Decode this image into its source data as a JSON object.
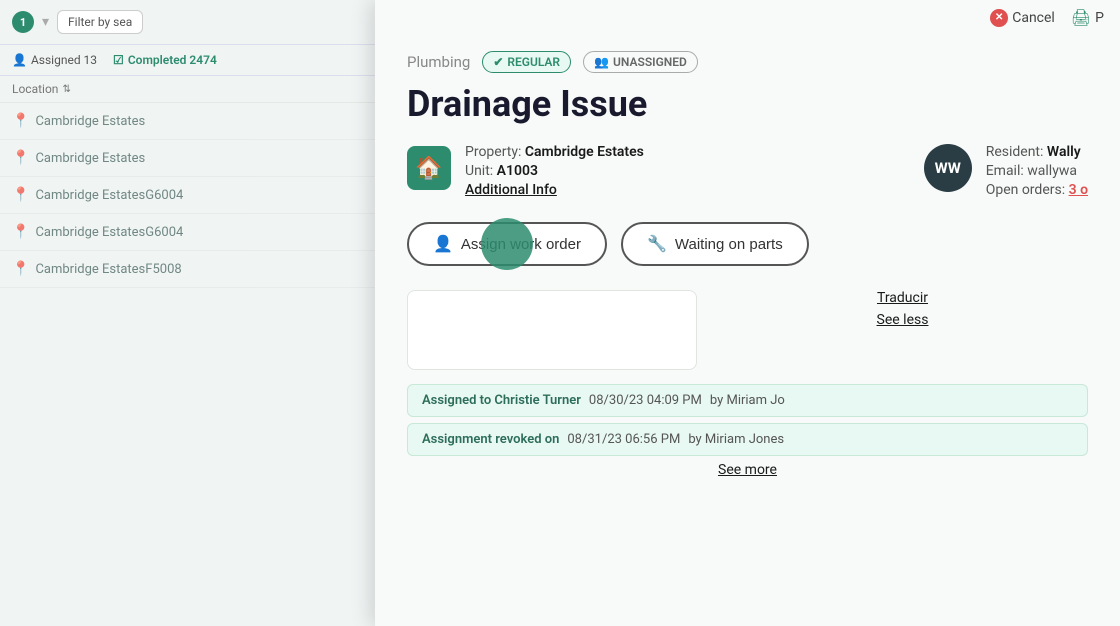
{
  "background": {
    "badge_count": "1",
    "filter_placeholder": "Filter by sea",
    "stat_assigned_label": "Assigned 13",
    "stat_completed_label": "Completed 2474",
    "column_location": "Location",
    "list_items": [
      {
        "location": "Cambridge Estates"
      },
      {
        "location": "Cambridge Estates"
      },
      {
        "location": "Cambridge EstatesG6004"
      },
      {
        "location": "Cambridge EstatesG6004"
      },
      {
        "location": "Cambridge EstatesF5008"
      }
    ]
  },
  "topbar": {
    "cancel_label": "Cancel",
    "print_label": "P"
  },
  "modal": {
    "category": "Plumbing",
    "badge_regular": "REGULAR",
    "badge_unassigned": "UNASSIGNED",
    "title": "Drainage Issue",
    "property_label": "Property:",
    "property_value": "Cambridge Estates",
    "unit_label": "Unit:",
    "unit_value": "A1003",
    "additional_info_label": "Additional Info",
    "resident_label": "Resident:",
    "resident_name": "Wally",
    "email_label": "Email:",
    "email_value": "wallywa",
    "open_orders_label": "Open orders:",
    "open_orders_value": "3 o",
    "avatar_initials": "WW",
    "btn_assign_label": "Assign work order",
    "btn_waiting_label": "Waiting on parts",
    "traducir_label": "Traducir",
    "see_less_label": "See less",
    "activity_items": [
      {
        "label": "Assigned to Christie Turner",
        "date": "08/30/23 04:09 PM",
        "by_prefix": "by Miriam Jo"
      },
      {
        "label": "Assignment revoked on",
        "date": "08/31/23 06:56 PM",
        "by_prefix": "by Miriam Jones"
      }
    ],
    "see_more_label": "See more"
  }
}
